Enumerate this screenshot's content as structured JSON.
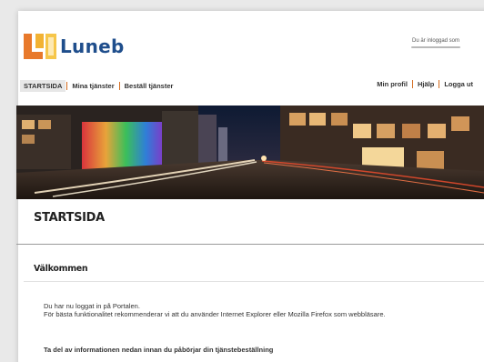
{
  "header": {
    "logo_text": "Luneb",
    "login_status": "Du är inloggad som"
  },
  "nav": {
    "left": [
      "STARTSIDA",
      "Mina tjänster",
      "Beställ tjänster"
    ],
    "right": [
      "Min profil",
      "Hjälp",
      "Logga ut"
    ]
  },
  "main": {
    "title": "STARTSIDA",
    "welcome_heading": "Välkommen",
    "intro_line1": "Du har nu loggat in på Portalen.",
    "intro_line2": "För bästa funktionalitet rekommenderar vi att du använder Internet Explorer eller Mozilla Firefox som webbläsare.",
    "notice": "Ta del av informationen nedan innan du påbörjar din tjänstebeställning"
  },
  "colors": {
    "logo_blue": "#1f4e8c",
    "logo_orange": "#e8792b",
    "logo_yellow": "#f6c64a",
    "nav_separator": "#d46b1e"
  }
}
